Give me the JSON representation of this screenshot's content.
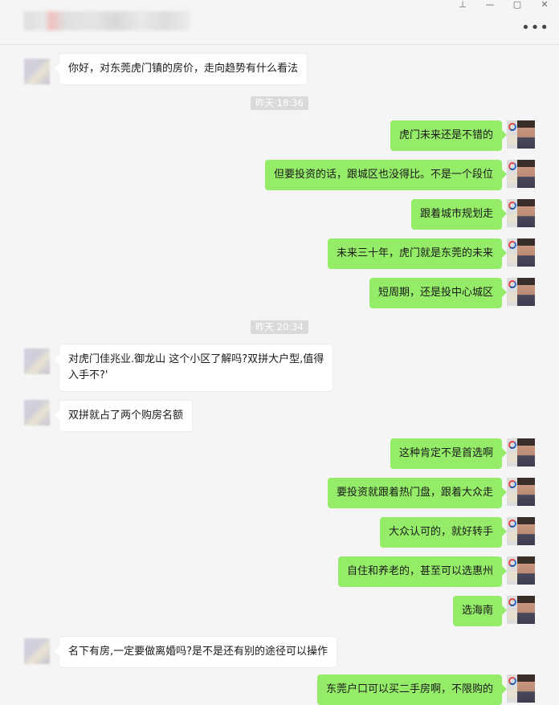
{
  "window": {
    "controls": {
      "pin": "⊥",
      "minimize": "—",
      "maximize": "▢",
      "close": "✕"
    },
    "more_icon": "•••"
  },
  "timestamps": [
    "昨天 18:36",
    "昨天 20:34"
  ],
  "messages": [
    {
      "side": "left",
      "text": "你好，对东莞虎门镇的房价，走向趋势有什么看法"
    },
    {
      "side": "right",
      "text": "虎门未来还是不错的"
    },
    {
      "side": "right",
      "text": "但要投资的话，跟城区也没得比。不是一个段位"
    },
    {
      "side": "right",
      "text": "跟着城市规划走"
    },
    {
      "side": "right",
      "text": "未来三十年，虎门就是东莞的未来"
    },
    {
      "side": "right",
      "text": "短周期，还是投中心城区"
    },
    {
      "side": "left",
      "text": "对虎门佳兆业.御龙山 这个小区了解吗?双拼大户型,值得\n入手不?'"
    },
    {
      "side": "left",
      "text": "双拼就占了两个购房名额"
    },
    {
      "side": "right",
      "text": "这种肯定不是首选啊"
    },
    {
      "side": "right",
      "text": "要投资就跟着热门盘，跟着大众走"
    },
    {
      "side": "right",
      "text": "大众认可的，就好转手"
    },
    {
      "side": "right",
      "text": "自住和养老的，甚至可以选惠州"
    },
    {
      "side": "right",
      "text": "选海南"
    },
    {
      "side": "left",
      "text": "名下有房,一定要做离婚吗?是不是还有别的途径可以操作"
    },
    {
      "side": "right",
      "text": "东莞户口可以买二手房啊，不限购的"
    }
  ]
}
